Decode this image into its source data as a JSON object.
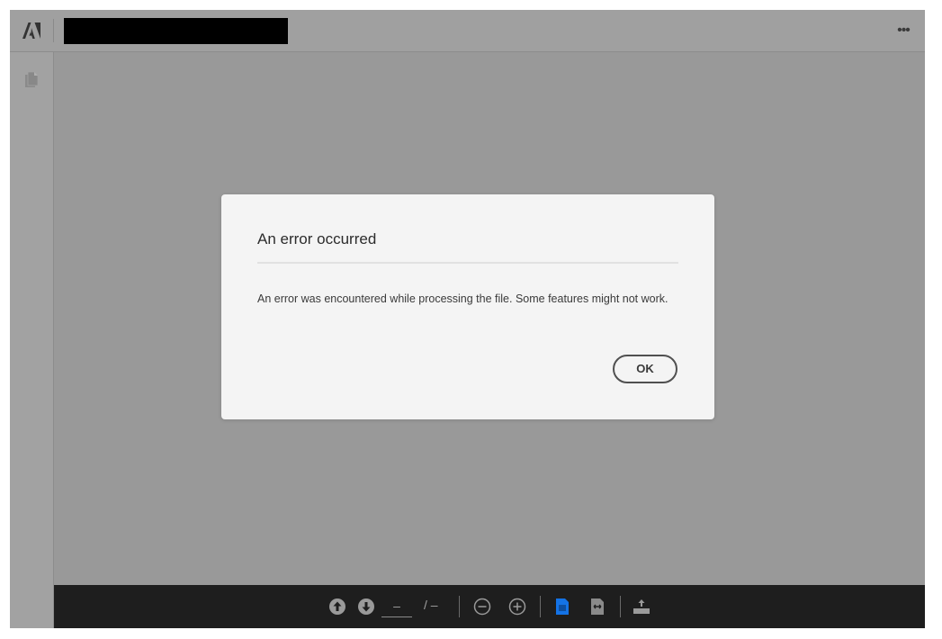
{
  "header": {
    "logo_icon": "adobe-logo-icon",
    "document_title": "",
    "more_icon": "ellipsis-icon",
    "more_label": "•••"
  },
  "sidebar": {
    "items": [
      {
        "icon": "page-thumbnails-icon"
      }
    ]
  },
  "dialog": {
    "title": "An error occurred",
    "message": "An error was encountered while processing the file. Some features might not work.",
    "ok_label": "OK"
  },
  "bottom_toolbar": {
    "previous_page_icon": "arrow-up-circle-icon",
    "next_page_icon": "arrow-down-circle-icon",
    "page_input_value": "–",
    "page_total": "/ –",
    "zoom_out_icon": "minus-circle-icon",
    "zoom_in_icon": "plus-circle-icon",
    "fit_page_icon": "fit-page-icon",
    "fit_width_icon": "fit-width-icon",
    "download_icon": "download-icon",
    "colors": {
      "background": "#1e1e1e",
      "icon": "#9a9a9a",
      "active_icon": "#1473e6"
    }
  },
  "colors": {
    "overlay": "#999999",
    "dialog_background": "#f4f4f4"
  }
}
